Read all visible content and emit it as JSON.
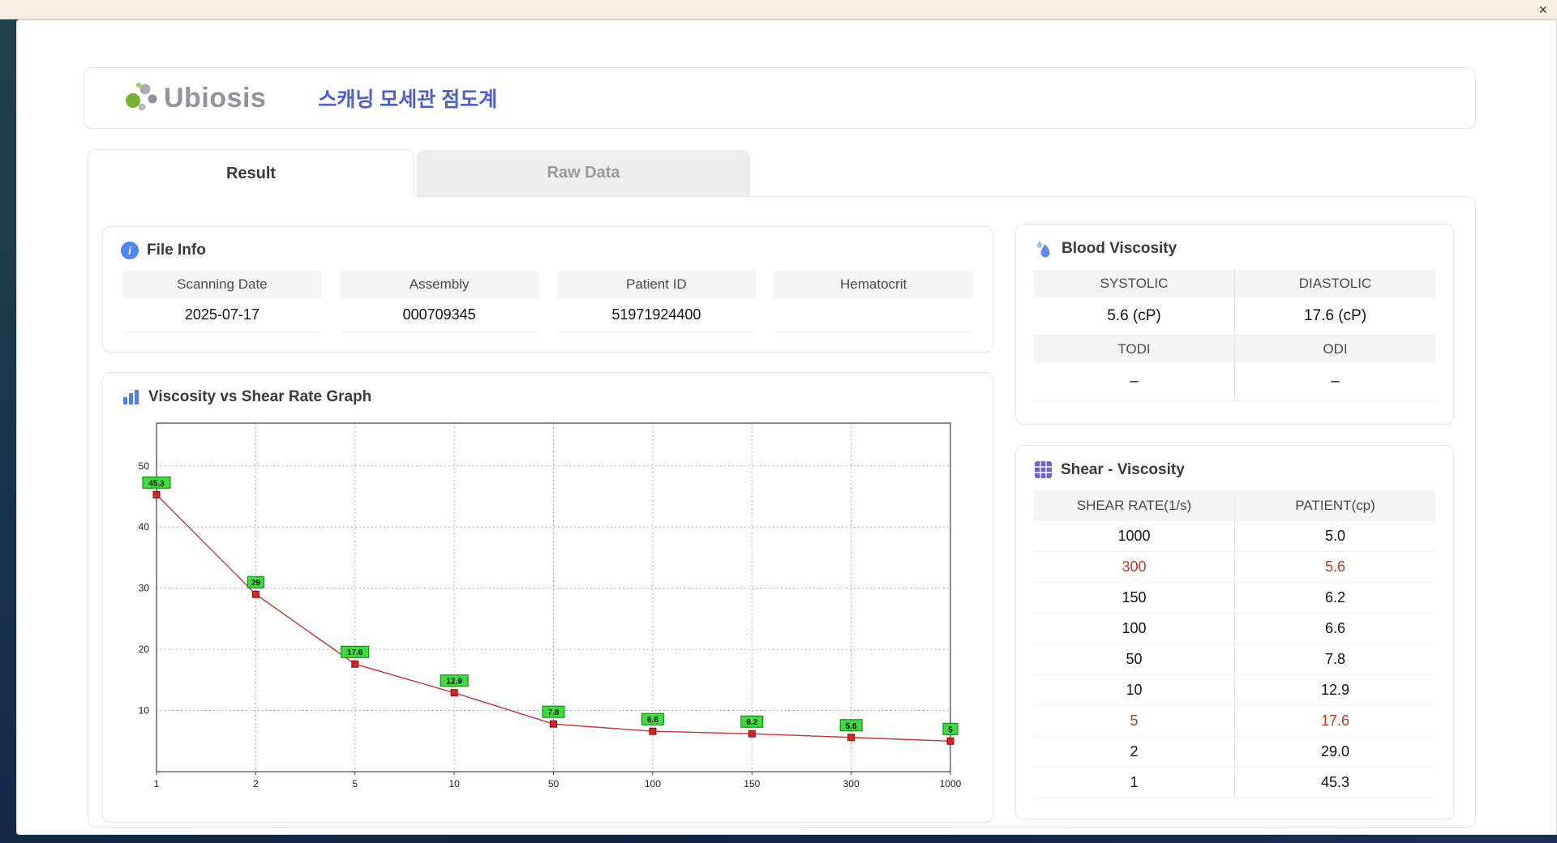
{
  "window": {
    "close_label": "×"
  },
  "header": {
    "logo_text": "Ubiosis",
    "title": "스캐닝 모세관 점도계"
  },
  "tabs": [
    {
      "label": "Result"
    },
    {
      "label": "Raw Data"
    }
  ],
  "file_info": {
    "title": "File Info",
    "fields": [
      {
        "label": "Scanning Date",
        "value": "2025-07-17"
      },
      {
        "label": "Assembly",
        "value": "000709345"
      },
      {
        "label": "Patient ID",
        "value": "51971924400"
      },
      {
        "label": "Hematocrit",
        "value": ""
      }
    ]
  },
  "blood_viscosity": {
    "title": "Blood Viscosity",
    "rows": [
      {
        "labels": [
          "SYSTOLIC",
          "DIASTOLIC"
        ],
        "values": [
          "5.6 (cP)",
          "17.6 (cP)"
        ]
      },
      {
        "labels": [
          "TODI",
          "ODI"
        ],
        "values": [
          "–",
          "–"
        ]
      }
    ]
  },
  "chart_data": {
    "type": "line",
    "title": "Viscosity vs Shear Rate Graph",
    "xlabel": "",
    "ylabel": "",
    "categories": [
      "1",
      "2",
      "5",
      "10",
      "50",
      "100",
      "150",
      "300",
      "1000"
    ],
    "values": [
      45.3,
      29,
      17.6,
      12.9,
      7.8,
      6.6,
      6.2,
      5.6,
      5
    ],
    "point_labels": [
      "45.3",
      "29",
      "17.6",
      "12.9",
      "7.8",
      "6.6",
      "6.2",
      "5.6",
      "5"
    ],
    "ylim": [
      0,
      57
    ],
    "yticks": [
      10,
      20,
      30,
      40,
      50
    ],
    "grid": true,
    "legend": "none",
    "line_color": "#c63434",
    "marker_color": "#dd2222",
    "marker_border": "#7a1010",
    "label_bg": "#3ddc3d",
    "label_border": "#0a7a0a"
  },
  "shear_table": {
    "title": "Shear - Viscosity",
    "columns": [
      "SHEAR RATE(1/s)",
      "PATIENT(cp)"
    ],
    "rows": [
      {
        "shear": "1000",
        "patient": "5.0",
        "highlight": false
      },
      {
        "shear": "300",
        "patient": "5.6",
        "highlight": true
      },
      {
        "shear": "150",
        "patient": "6.2",
        "highlight": false
      },
      {
        "shear": "100",
        "patient": "6.6",
        "highlight": false
      },
      {
        "shear": "50",
        "patient": "7.8",
        "highlight": false
      },
      {
        "shear": "10",
        "patient": "12.9",
        "highlight": false
      },
      {
        "shear": "5",
        "patient": "17.6",
        "highlight": true
      },
      {
        "shear": "2",
        "patient": "29.0",
        "highlight": false
      },
      {
        "shear": "1",
        "patient": "45.3",
        "highlight": false
      }
    ]
  },
  "colors": {
    "accent_blue": "#4f86f7",
    "title_purple": "#4d5ed0",
    "highlight_red": "#c0392b",
    "label_green": "#3ddc3d"
  }
}
